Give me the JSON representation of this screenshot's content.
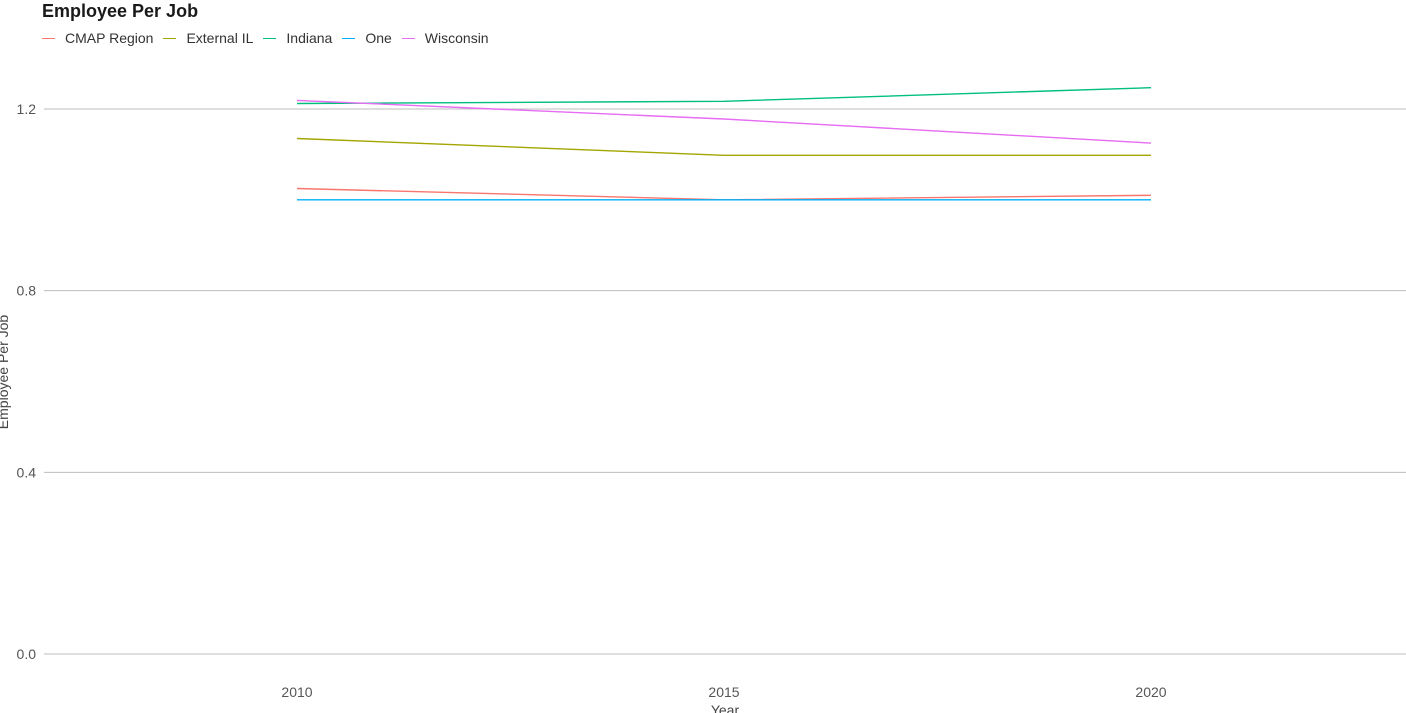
{
  "chart_data": {
    "type": "line",
    "title": "Employee Per Job",
    "xlabel": "Year",
    "ylabel": "Employee Per Job",
    "x": [
      2010,
      2015,
      2020
    ],
    "xlim": [
      2007,
      2023
    ],
    "ylim": [
      0,
      1.32
    ],
    "yticks": [
      0.0,
      0.4,
      0.8,
      1.2
    ],
    "ytick_labels": [
      "0.0",
      "0.4",
      "0.8",
      "1.2"
    ],
    "xticks": [
      2010,
      2015,
      2020
    ],
    "xtick_labels": [
      "2010",
      "2015",
      "2020"
    ],
    "grid": "horizontal",
    "legend_position": "top-left",
    "series": [
      {
        "name": "CMAP Region",
        "color": "#F8766D",
        "values": [
          1.025,
          1.0,
          1.01
        ]
      },
      {
        "name": "External IL",
        "color": "#A3A500",
        "values": [
          1.135,
          1.098,
          1.098
        ]
      },
      {
        "name": "Indiana",
        "color": "#00BF7D",
        "values": [
          1.212,
          1.217,
          1.247
        ]
      },
      {
        "name": "One",
        "color": "#00B0F6",
        "values": [
          1.0,
          1.0,
          1.0
        ]
      },
      {
        "name": "Wisconsin",
        "color": "#E76BF3",
        "values": [
          1.219,
          1.178,
          1.125
        ]
      }
    ]
  }
}
